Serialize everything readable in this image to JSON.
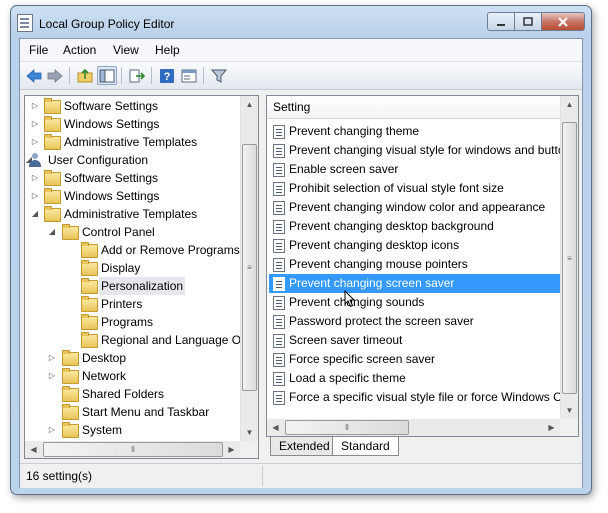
{
  "window": {
    "title": "Local Group Policy Editor"
  },
  "menu": [
    "File",
    "Action",
    "View",
    "Help"
  ],
  "toolbar": {
    "buttons": [
      "back-icon",
      "forward-icon",
      "up-folder-icon",
      "show-hide-tree-icon",
      "export-list-icon",
      "help-icon",
      "properties-icon",
      "filter-icon"
    ]
  },
  "tree": {
    "items": [
      {
        "label": "Software Settings",
        "icon": "folder-icon",
        "expander": "collapsed"
      },
      {
        "label": "Windows Settings",
        "icon": "folder-icon",
        "expander": "collapsed"
      },
      {
        "label": "Administrative Templates",
        "icon": "folder-icon",
        "expander": "collapsed"
      },
      {
        "label": "User Configuration",
        "icon": "user-icon",
        "expander": "expanded"
      },
      {
        "label": "Software Settings",
        "icon": "folder-icon",
        "expander": "collapsed"
      },
      {
        "label": "Windows Settings",
        "icon": "folder-icon",
        "expander": "collapsed"
      },
      {
        "label": "Administrative Templates",
        "icon": "folder-icon",
        "expander": "expanded"
      },
      {
        "label": "Control Panel",
        "icon": "folder-icon",
        "expander": "expanded"
      },
      {
        "label": "Add or Remove Programs",
        "icon": "folder-icon",
        "expander": "none"
      },
      {
        "label": "Display",
        "icon": "folder-icon",
        "expander": "none"
      },
      {
        "label": "Personalization",
        "icon": "folder-icon",
        "expander": "none",
        "selected": true
      },
      {
        "label": "Printers",
        "icon": "folder-icon",
        "expander": "none"
      },
      {
        "label": "Programs",
        "icon": "folder-icon",
        "expander": "none"
      },
      {
        "label": "Regional and Language Options",
        "icon": "folder-icon",
        "expander": "none"
      },
      {
        "label": "Desktop",
        "icon": "folder-icon",
        "expander": "collapsed"
      },
      {
        "label": "Network",
        "icon": "folder-icon",
        "expander": "collapsed"
      },
      {
        "label": "Shared Folders",
        "icon": "folder-icon",
        "expander": "none"
      },
      {
        "label": "Start Menu and Taskbar",
        "icon": "folder-icon",
        "expander": "none"
      },
      {
        "label": "System",
        "icon": "folder-icon",
        "expander": "collapsed"
      }
    ]
  },
  "settings": {
    "column_header": "Setting",
    "items": [
      {
        "label": "Prevent changing theme"
      },
      {
        "label": "Prevent changing visual style for windows and buttons"
      },
      {
        "label": "Enable screen saver"
      },
      {
        "label": "Prohibit selection of visual style font size"
      },
      {
        "label": "Prevent changing window color and appearance"
      },
      {
        "label": "Prevent changing desktop background"
      },
      {
        "label": "Prevent changing desktop icons"
      },
      {
        "label": "Prevent changing mouse pointers"
      },
      {
        "label": "Prevent changing screen saver",
        "selected": true
      },
      {
        "label": "Prevent changing sounds"
      },
      {
        "label": "Password protect the screen saver"
      },
      {
        "label": "Screen saver timeout"
      },
      {
        "label": "Force specific screen saver"
      },
      {
        "label": "Load a specific theme"
      },
      {
        "label": "Force a specific visual style file or force Windows Classic"
      }
    ]
  },
  "tabs": [
    "Extended",
    "Standard"
  ],
  "active_tab": "Standard",
  "status": {
    "text": "16 setting(s)"
  },
  "colors": {
    "selection": "#3399ff",
    "title_bar": "#bcd3ec",
    "folder": "#e8c45a"
  }
}
